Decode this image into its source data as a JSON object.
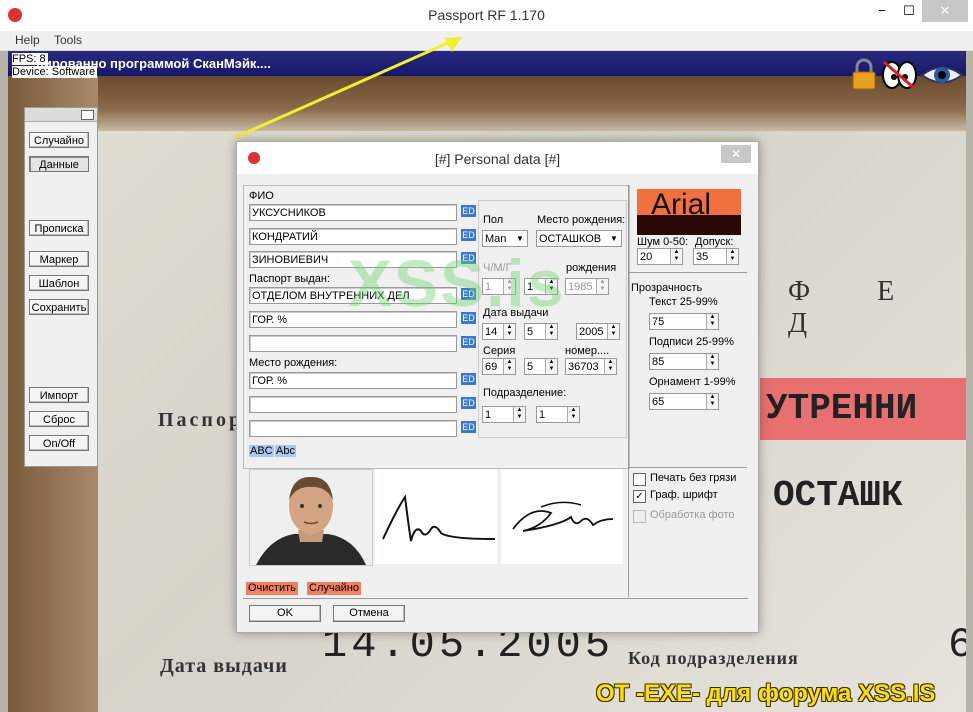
{
  "window": {
    "title": "Passport RF 1.170",
    "minimize": "−",
    "maximize": "☐",
    "close": "✕"
  },
  "menu": {
    "items": [
      "Help",
      "Tools"
    ]
  },
  "overlay": {
    "fps": "FPS: 8",
    "device": "Device: Software",
    "banner": "нированно программой СканМэйк...."
  },
  "bg": {
    "country": "Ф Е Д",
    "passport_label": "Паспор",
    "red_text": "УТРЕННИ",
    "place_text": "ОСТАШК",
    "date_big": "14.05.2005",
    "date_label": "Дата выдачи",
    "code_label": "Код подразделения",
    "edge_digit": "6"
  },
  "watermark": "XSS.is",
  "footer_credit": "ОТ -EXE- для форума XSS.IS",
  "left_panel": {
    "buttons": [
      "Случайно",
      "Данные",
      "Прописка",
      "Маркер",
      "Шаблон",
      "Сохранить",
      "Импорт",
      "Сброс",
      "On/Off"
    ]
  },
  "dialog": {
    "title": "[#] Personal data [#]",
    "close": "✕",
    "fio_label": "ФИО",
    "fio": [
      "УКСУСНИКОВ",
      "КОНДРАТИЙ",
      "ЗИНОВИЕВИЧ"
    ],
    "passport_issued_label": "Паспорт выдан:",
    "issued": [
      "ОТДЕЛОМ ВНУТРЕННИХ ДЕЛ",
      "ГОР. %",
      ""
    ],
    "birthplace_label": "Место рождения:",
    "birthplace": [
      "ГОР. %",
      "",
      ""
    ],
    "ed_label": "ED",
    "abc_upper": "ABC",
    "abc_title": "Abc",
    "sex_label": "Пол",
    "sex_value": "Man",
    "birthplace_combo_label": "Место рождения:",
    "birthplace_combo_value": "ОСТАШКОВ",
    "dmy_label": "Ч/М/Г",
    "birth_label": "рождения",
    "birth_d": "1",
    "birth_m": "1",
    "birth_y": "1985",
    "issue_date_label": "Дата выдачи",
    "issue_d": "14",
    "issue_m": "5",
    "issue_y": "2005",
    "series_label": "Серия",
    "series_a": "69",
    "series_b": "5",
    "number_label": "номер....",
    "number_value": "36703",
    "division_label": "Подразделение:",
    "div_a": "1",
    "div_b": "1",
    "font_preview": "Arial",
    "noise_label": "Шум 0-50:",
    "noise_value": "20",
    "tolerance_label": "Допуск:",
    "tolerance_value": "35",
    "transparency_label": "Прозрачность",
    "text_label": "Текст 25-99%",
    "text_value": "75",
    "sign_label": "Подписи 25-99%",
    "sign_value": "85",
    "ornament_label": "Орнамент 1-99%",
    "ornament_value": "65",
    "chk_print": "Печать без грязи",
    "chk_graph": "Граф. шрифт",
    "chk_photo": "Обработка фото",
    "chk_graph_mark": "✓",
    "btn_clear": "Очистить",
    "btn_random": "Случайно",
    "ok": "OK",
    "cancel": "Отмена"
  },
  "colors": {
    "accent_blue": "#3a78d4",
    "orange": "#f08060",
    "font_preview": "#f07040"
  }
}
